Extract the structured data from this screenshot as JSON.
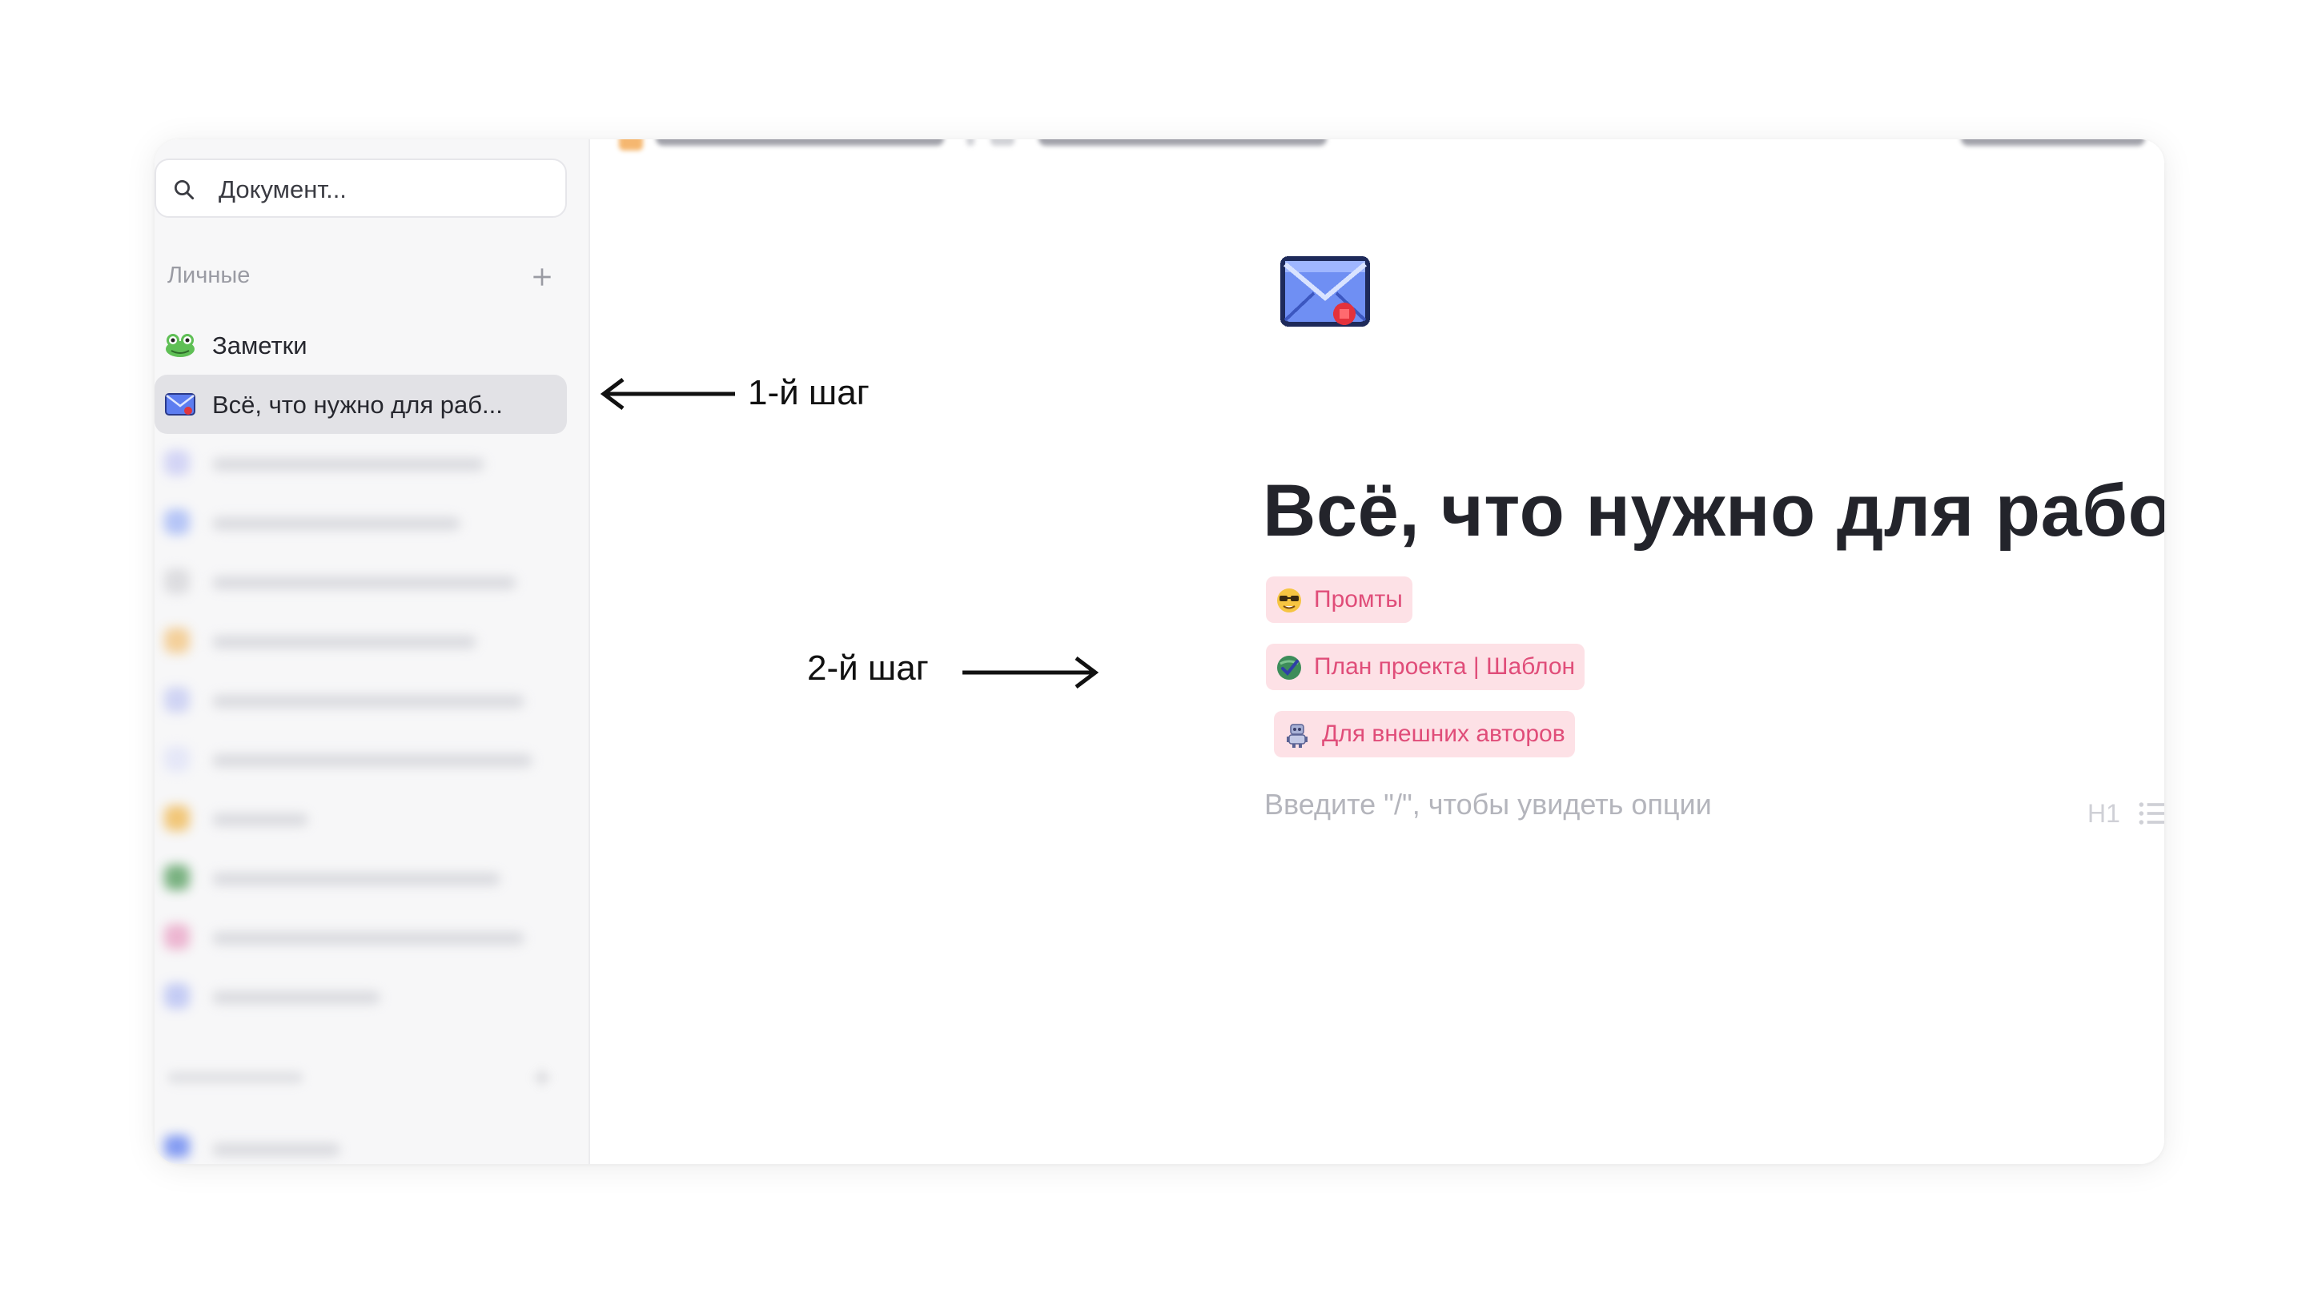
{
  "sidebar": {
    "search": {
      "placeholder": "Документ..."
    },
    "section_personal": {
      "label": "Личные"
    },
    "items": [
      {
        "label": "Заметки",
        "icon": "frog-icon"
      },
      {
        "label": "Всё, что нужно для раб...",
        "icon": "envelope-icon",
        "active": true
      }
    ]
  },
  "main": {
    "page_title": "Всё, что нужно для работы",
    "page_icon": "envelope-icon",
    "links": [
      {
        "label": "Промты",
        "icon": "nerd-face-icon"
      },
      {
        "label": "План проекта | Шаблон",
        "icon": "check-globe-icon"
      },
      {
        "label": "Для внешних авторов",
        "icon": "robot-icon"
      }
    ],
    "editor_placeholder": "Введите \"/\", чтобы увидеть опции",
    "toolbar": {
      "heading_label": "H1"
    }
  },
  "annotations": {
    "step1": "1-й шаг",
    "step2": "2-й шаг"
  },
  "colors": {
    "chip_bg": "#fde1e6",
    "chip_text": "#e04d79",
    "active_item_bg": "#e2e2e6",
    "title_text": "#23242b"
  }
}
